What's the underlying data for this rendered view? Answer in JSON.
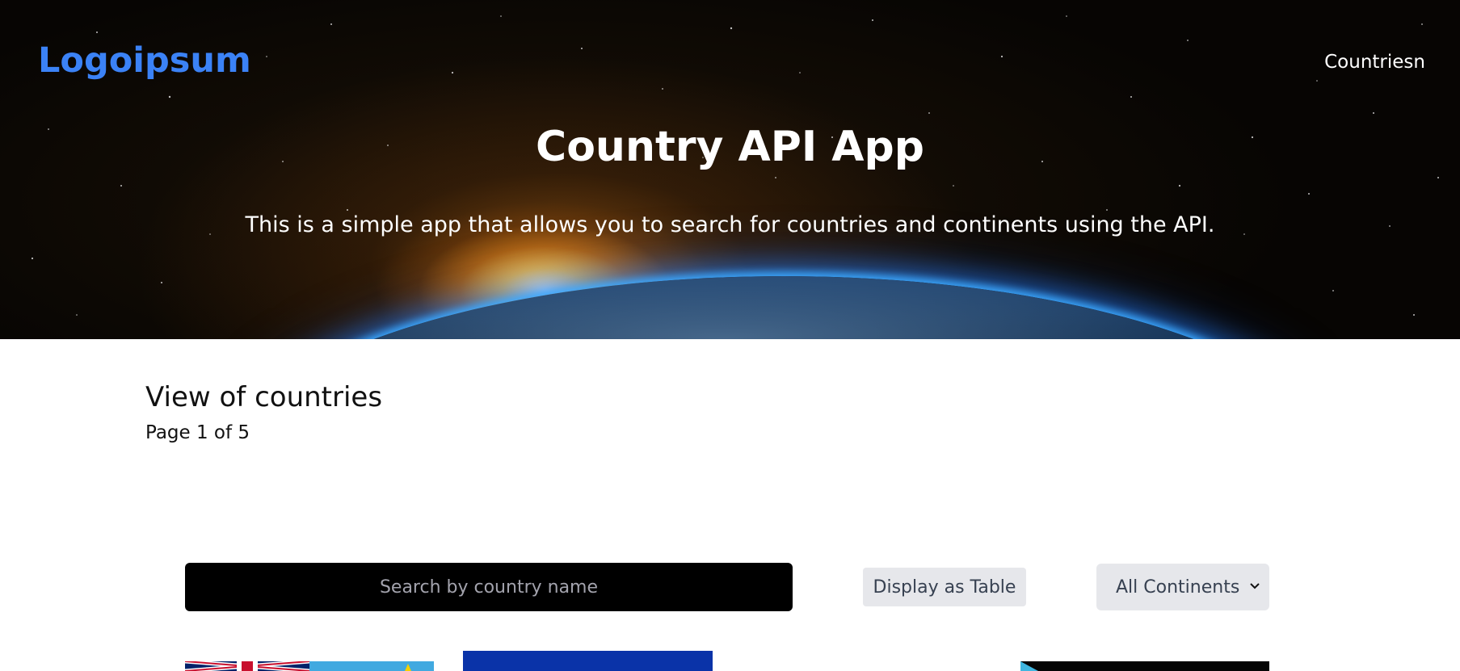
{
  "header": {
    "logo": "Logoipsum",
    "nav_link": "Countriesn"
  },
  "hero": {
    "title": "Country API App",
    "subtitle": "This is a simple app that allows you to search for countries and continents using the API."
  },
  "main": {
    "section_title": "View of countries",
    "page_info": "Page 1 of 5",
    "search": {
      "placeholder": "Search by country name",
      "value": ""
    },
    "display_button": "Display as Table",
    "continent_select": {
      "selected": "All Continents"
    }
  },
  "colors": {
    "logo": "#3b82f6",
    "search_bg": "#000000",
    "button_bg": "#e6e7eb"
  }
}
